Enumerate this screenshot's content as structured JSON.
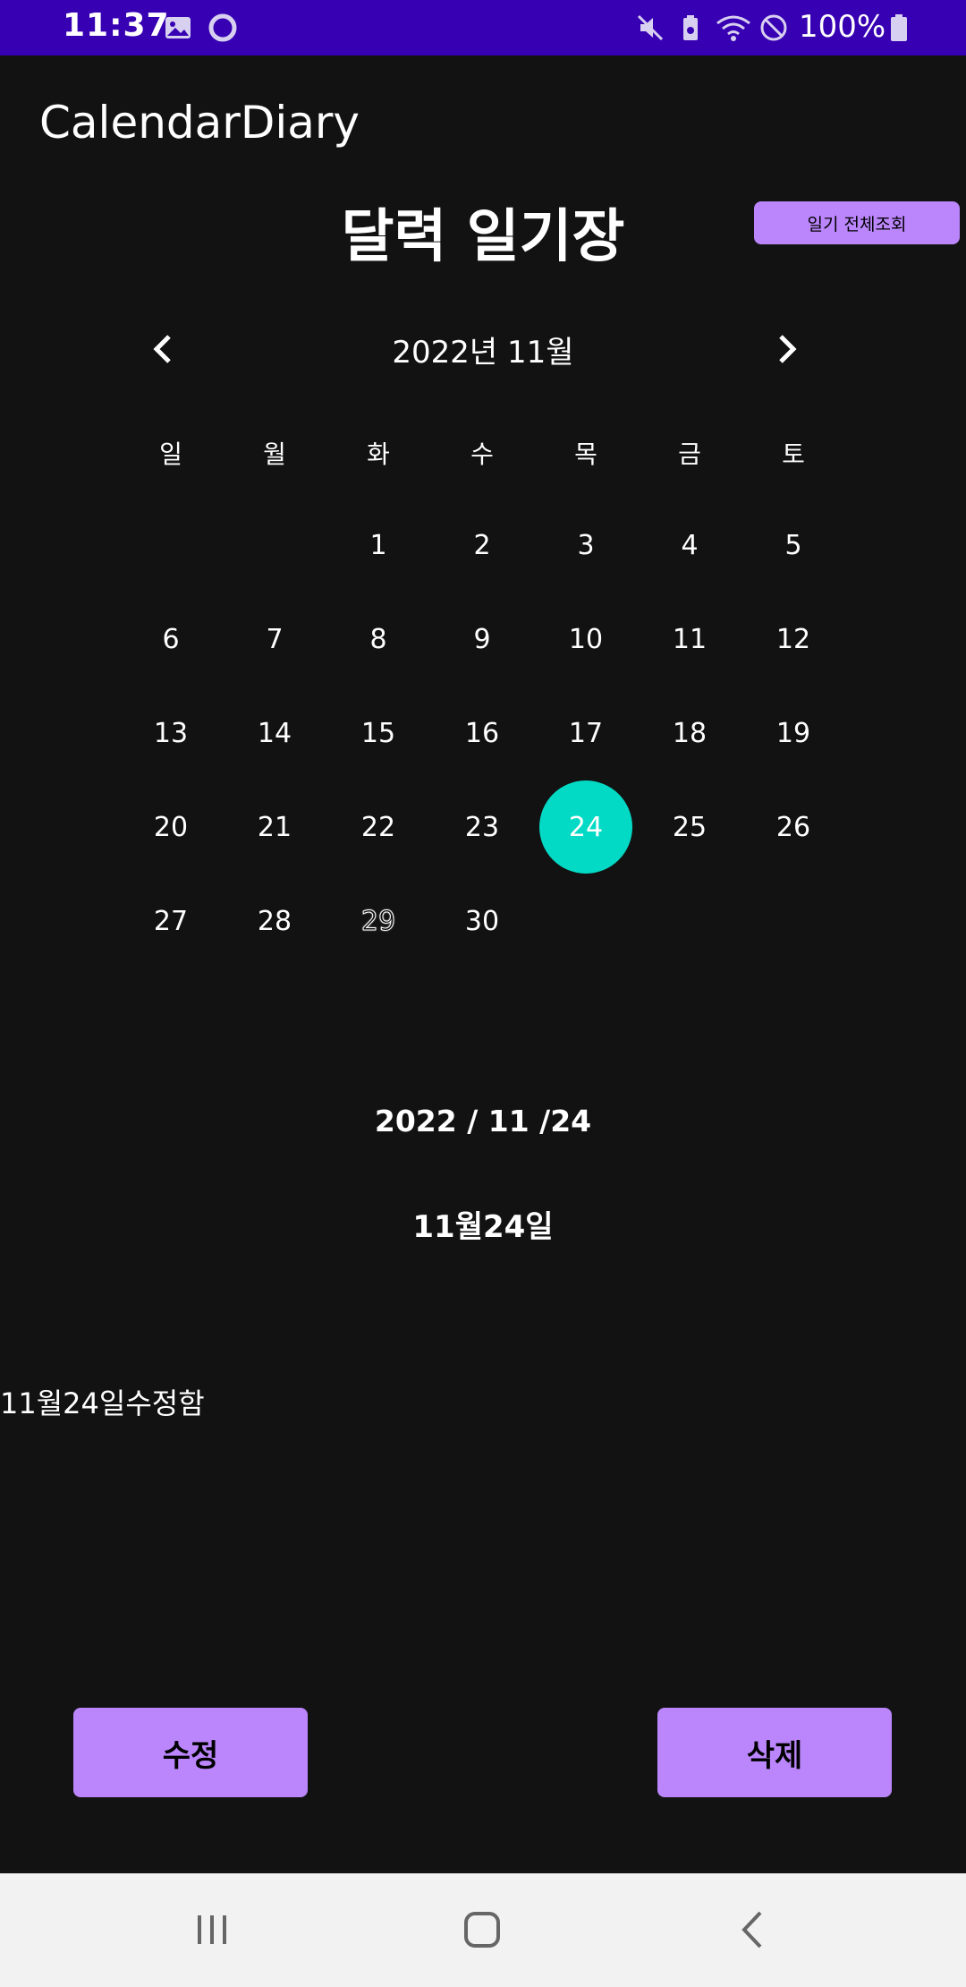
{
  "status_bar": {
    "time": "11:37",
    "battery_text": "100%",
    "icons": [
      "image-icon",
      "circle-sync-icon",
      "mute-icon",
      "battery-saver-icon",
      "wifi-icon",
      "do-not-disturb-icon",
      "battery-icon"
    ]
  },
  "app_bar": {
    "title": "CalendarDiary"
  },
  "header": {
    "title": "달력 일기장",
    "view_all_label": "일기 전체조회"
  },
  "calendar": {
    "month_label": "2022년 11월",
    "weekdays": [
      "일",
      "월",
      "화",
      "수",
      "목",
      "금",
      "토"
    ],
    "weeks": [
      [
        "",
        "",
        "1",
        "2",
        "3",
        "4",
        "5"
      ],
      [
        "6",
        "7",
        "8",
        "9",
        "10",
        "11",
        "12"
      ],
      [
        "13",
        "14",
        "15",
        "16",
        "17",
        "18",
        "19"
      ],
      [
        "20",
        "21",
        "22",
        "23",
        "24",
        "25",
        "26"
      ],
      [
        "27",
        "28",
        "29",
        "30",
        "",
        "",
        ""
      ]
    ],
    "selected_day": "24",
    "today_day": "29",
    "selected_color": "#03dac5"
  },
  "detail": {
    "selected_date": "2022 / 11 /24",
    "entry_title": "11월24일",
    "entry_content": "11월24일수정함"
  },
  "actions": {
    "edit_label": "수정",
    "delete_label": "삭제"
  },
  "colors": {
    "status_bar": "#3700b3",
    "accent": "#bb86fc",
    "background": "#121212"
  }
}
